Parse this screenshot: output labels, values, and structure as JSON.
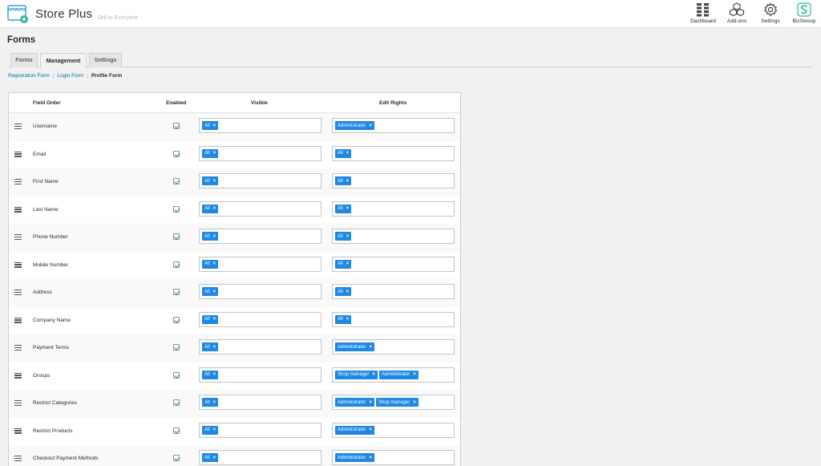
{
  "header": {
    "brand_name": "Store Plus",
    "tagline": "Sell to Everyone",
    "nav": [
      {
        "label": "Dashboard",
        "icon": "dashboard-icon"
      },
      {
        "label": "Add-ons",
        "icon": "addons-icon"
      },
      {
        "label": "Settings",
        "icon": "gear-icon"
      },
      {
        "label": "BizSwoop",
        "icon": "bizswoop-logo-icon"
      }
    ]
  },
  "page": {
    "title": "Forms"
  },
  "tabs": [
    {
      "label": "Forms",
      "active": false
    },
    {
      "label": "Management",
      "active": true
    },
    {
      "label": "Settings",
      "active": false
    }
  ],
  "subnav": {
    "links": [
      "Registration Form",
      "Login Form"
    ],
    "current": "Profile Form",
    "separator": "|"
  },
  "table": {
    "headers": {
      "field_order": "Field Order",
      "enabled": "Enabled",
      "visible": "Visible",
      "edit_rights": "Edit Rights"
    },
    "chip_remove": "×",
    "rows": [
      {
        "name": "Username",
        "enabled": true,
        "visible": [
          "All"
        ],
        "edit": [
          "Administrator"
        ]
      },
      {
        "name": "Email",
        "enabled": true,
        "visible": [
          "All"
        ],
        "edit": [
          "All"
        ]
      },
      {
        "name": "First Name",
        "enabled": true,
        "visible": [
          "All"
        ],
        "edit": [
          "All"
        ]
      },
      {
        "name": "Last Name",
        "enabled": true,
        "visible": [
          "All"
        ],
        "edit": [
          "All"
        ]
      },
      {
        "name": "Phone Number",
        "enabled": true,
        "visible": [
          "All"
        ],
        "edit": [
          "All"
        ]
      },
      {
        "name": "Mobile Number",
        "enabled": true,
        "visible": [
          "All"
        ],
        "edit": [
          "All"
        ]
      },
      {
        "name": "Address",
        "enabled": true,
        "visible": [
          "All"
        ],
        "edit": [
          "All"
        ]
      },
      {
        "name": "Company Name",
        "enabled": true,
        "visible": [
          "All"
        ],
        "edit": [
          "All"
        ]
      },
      {
        "name": "Payment Terms",
        "enabled": true,
        "visible": [
          "All"
        ],
        "edit": [
          "Administrator"
        ]
      },
      {
        "name": "Groups",
        "enabled": true,
        "visible": [
          "All"
        ],
        "edit": [
          "Shop manager",
          "Administrator"
        ]
      },
      {
        "name": "Restrict Categories",
        "enabled": true,
        "visible": [
          "All"
        ],
        "edit": [
          "Administrator",
          "Shop manager"
        ]
      },
      {
        "name": "Restrict Products",
        "enabled": true,
        "visible": [
          "All"
        ],
        "edit": [
          "Administrator"
        ]
      },
      {
        "name": "Checkout Payment Methods",
        "enabled": true,
        "visible": [
          "All"
        ],
        "edit": [
          "Administrator"
        ]
      }
    ]
  },
  "colors": {
    "chip": "#1e88e5",
    "link": "#0073aa",
    "checkmark": "#1e8cbe",
    "bizswoop": "#2fb5a0"
  }
}
